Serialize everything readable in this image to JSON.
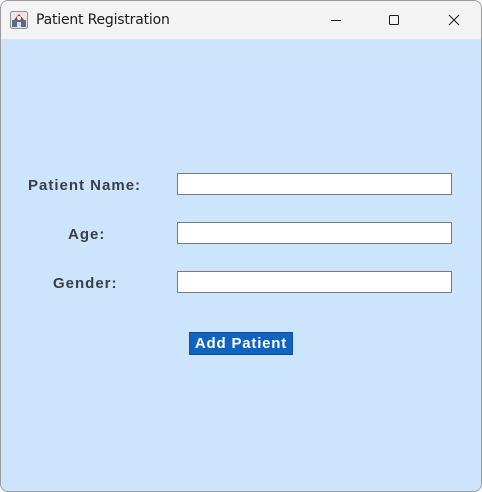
{
  "window": {
    "title": "Patient Registration",
    "app_icon": "java-app-icon",
    "controls": {
      "minimize": "minimize-icon",
      "maximize": "maximize-icon",
      "close": "close-icon"
    }
  },
  "form": {
    "patient_name_label": "Patient Name:",
    "patient_name_value": "",
    "age_label": "Age:",
    "age_value": "",
    "gender_label": "Gender:",
    "gender_value": "",
    "submit_label": "Add Patient"
  },
  "colors": {
    "background": "#cce4fc",
    "titlebar": "#f3f3f3",
    "button": "#1163c0",
    "label_text": "#3a3f47"
  }
}
